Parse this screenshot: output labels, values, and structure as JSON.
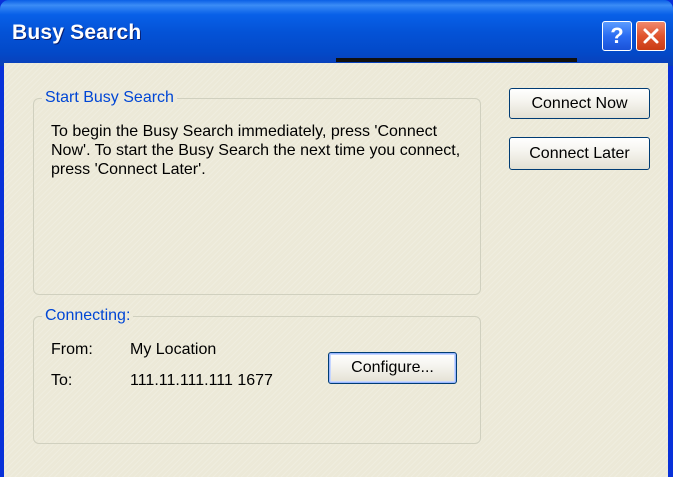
{
  "window": {
    "title": "Busy Search",
    "help_glyph": "?",
    "close_glyph": "✕"
  },
  "start_group": {
    "legend": "Start Busy Search",
    "description": "To begin the Busy Search immediately, press 'Connect Now'.  To start the Busy Search the next time you connect, press 'Connect Later'."
  },
  "connecting_group": {
    "legend": "Connecting:",
    "from_label": "From:",
    "from_value": "My Location",
    "to_label": "To:",
    "to_value": "111.11.111.111 1677"
  },
  "buttons": {
    "connect_now": "Connect Now",
    "connect_later": "Connect Later",
    "configure": "Configure..."
  }
}
